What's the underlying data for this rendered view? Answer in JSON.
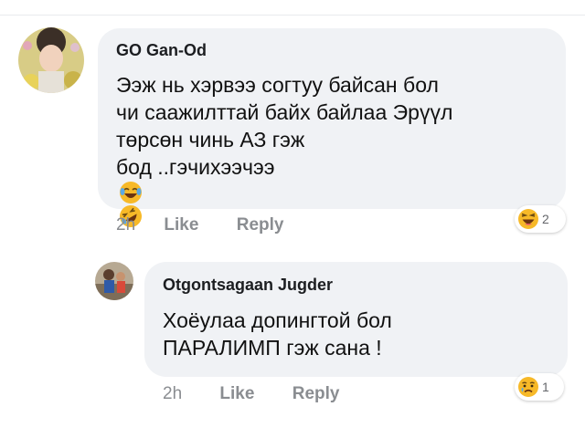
{
  "comments": [
    {
      "author": "GO Gan-Od",
      "lines": [
        "Ээж нь хэрвээ согтуу байсан бол",
        "чи саажилттай байх байлаа Эрүүл",
        "төрсөн чинь АЗ гэж",
        "бод ..гэчихээчээ"
      ],
      "inline_emojis": [
        "laughing-tears-emoji",
        "rolling-laughing-emoji"
      ],
      "time": "2h",
      "like_label": "Like",
      "reply_label": "Reply",
      "reaction": {
        "icon": "haha-reaction-icon",
        "count": "2"
      }
    },
    {
      "author": "Otgontsagaan Jugder",
      "lines": [
        "Хоёулаа допингтой бол",
        "ПАРАЛИМП гэж сана !"
      ],
      "time": "2h",
      "like_label": "Like",
      "reply_label": "Reply",
      "reaction": {
        "icon": "sad-reaction-icon",
        "count": "1"
      }
    }
  ],
  "colors": {
    "bubble": "#f0f2f5",
    "muted_text": "#8a8d91",
    "reaction_yellow": "#f7b928"
  }
}
